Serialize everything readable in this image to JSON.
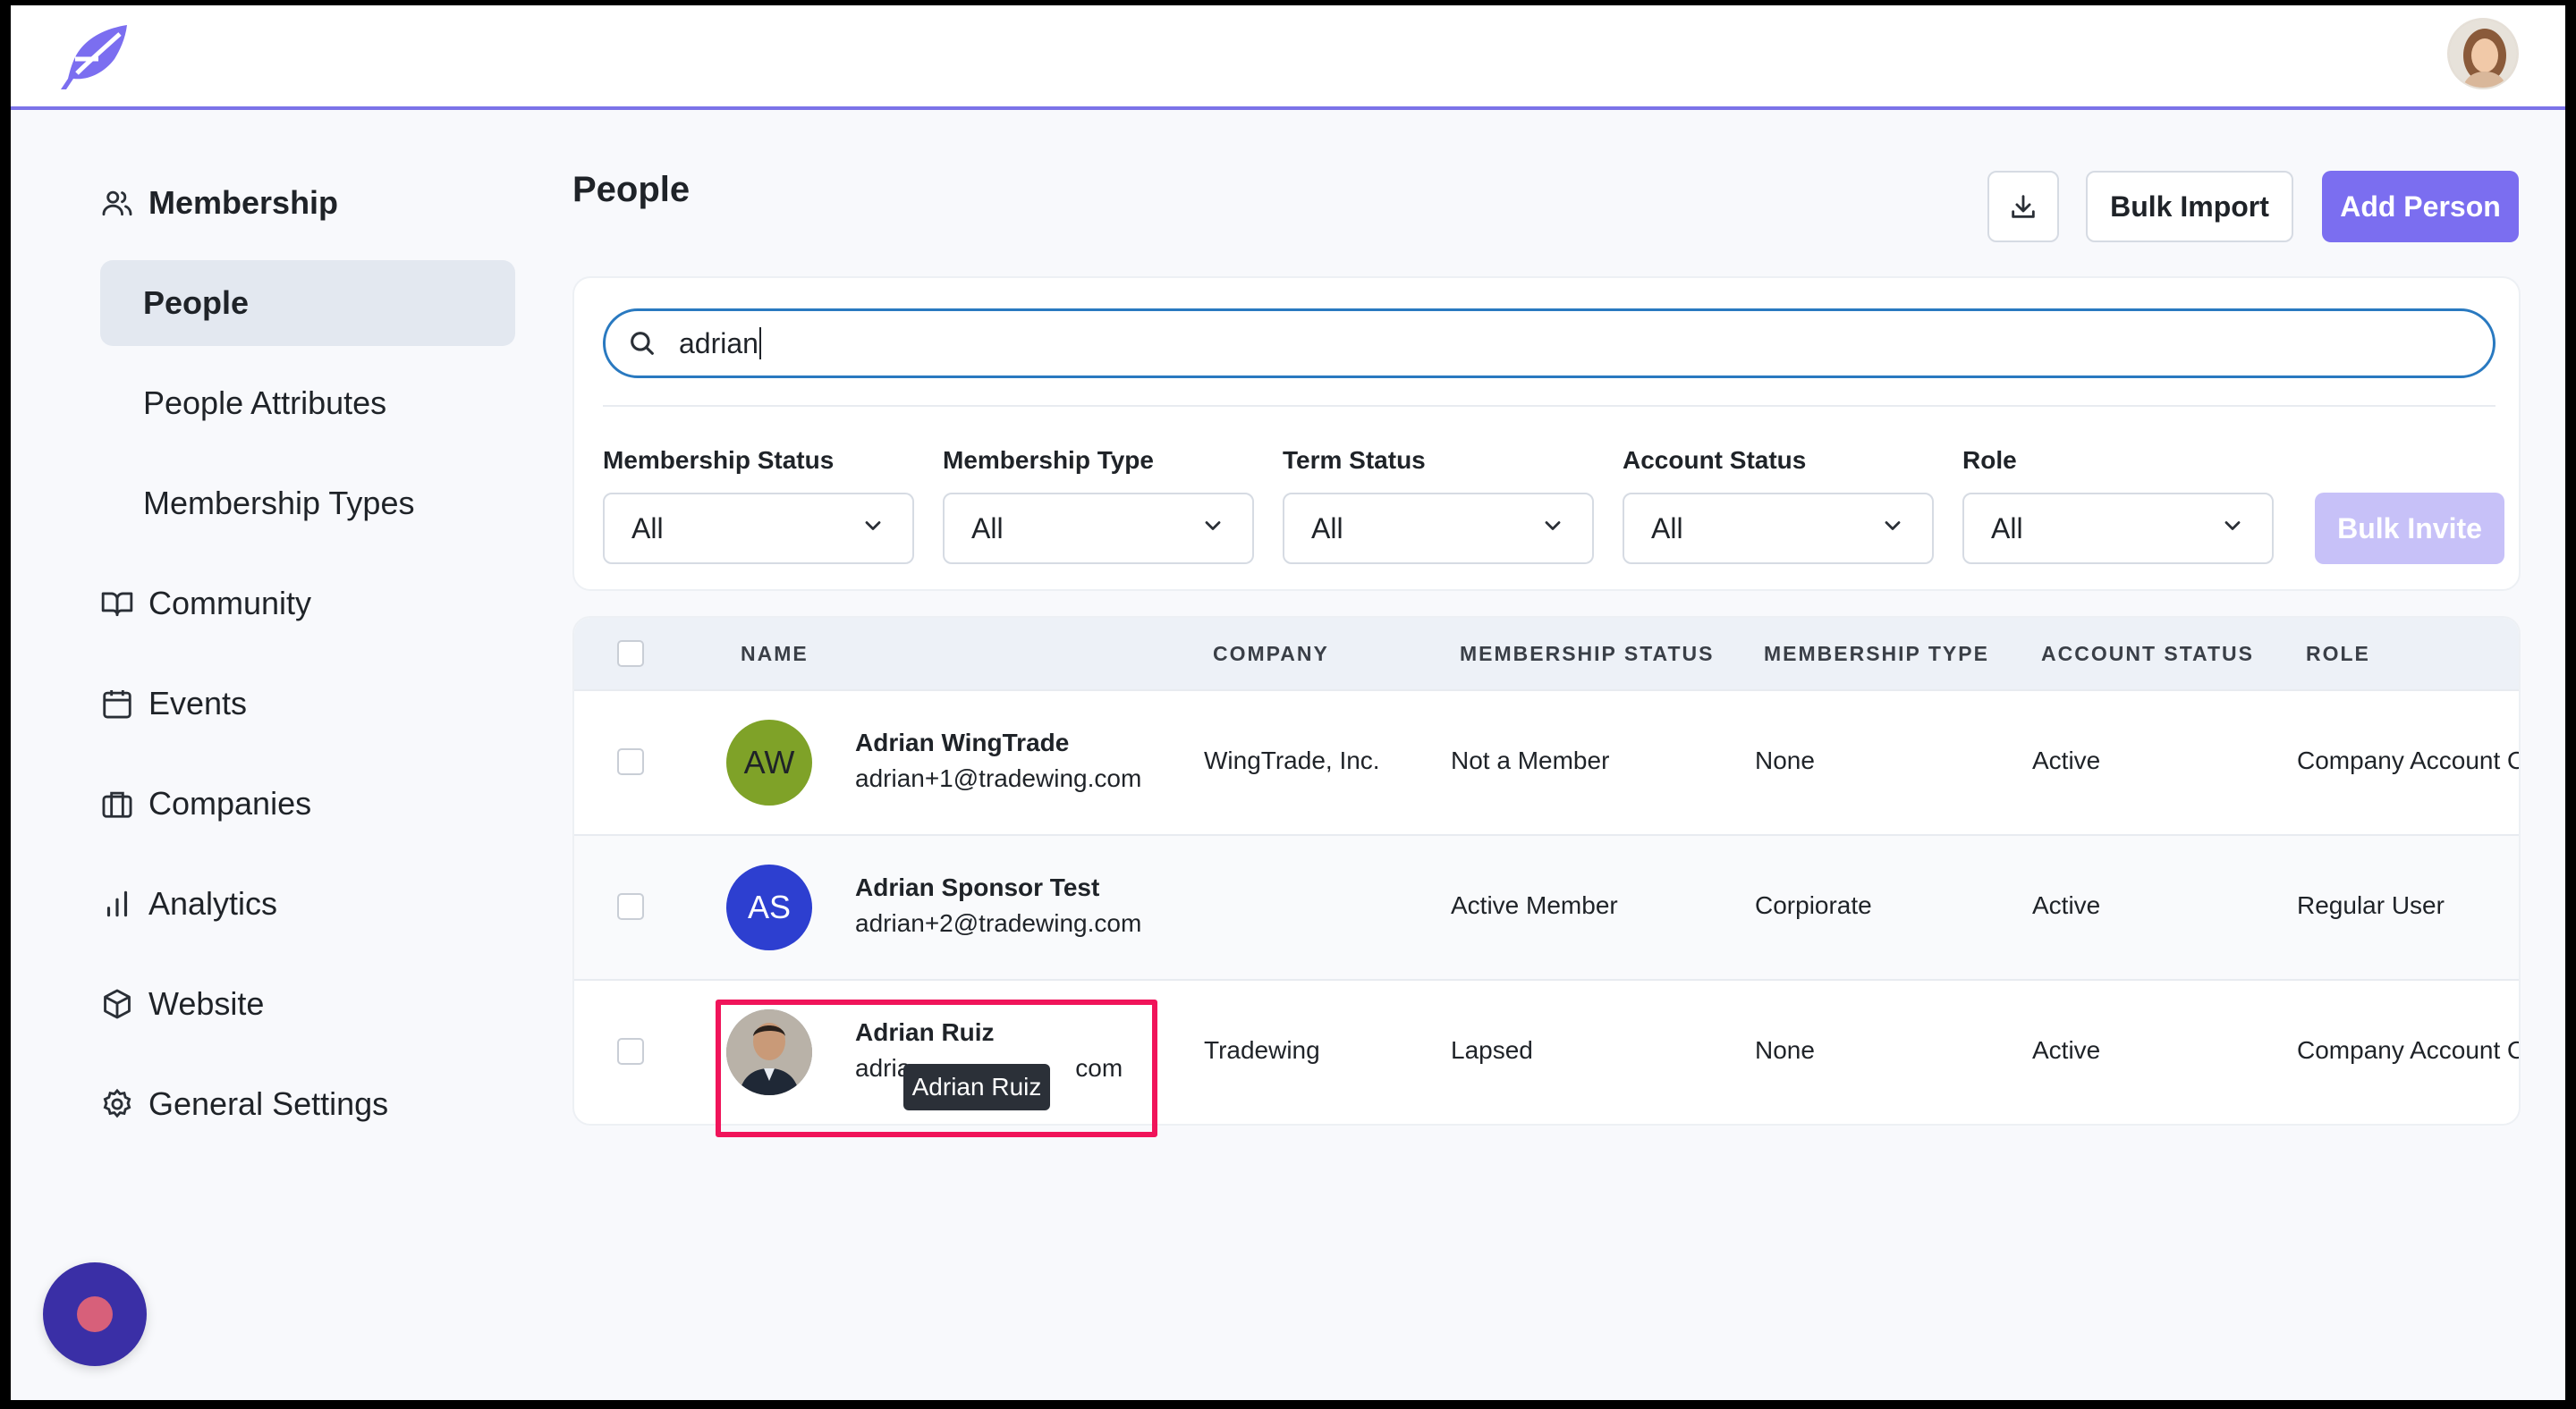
{
  "brand": {
    "accent": "#7b6ef0",
    "focus": "#2979c0",
    "highlight": "#f0145a"
  },
  "header": {
    "logo_icon": "feather-logo-icon",
    "user_avatar": "user-avatar-photo"
  },
  "sidebar": {
    "sections": [
      {
        "label": "Membership",
        "icon": "users-icon"
      },
      {
        "label": "Community",
        "icon": "book-open-icon"
      },
      {
        "label": "Events",
        "icon": "calendar-icon"
      },
      {
        "label": "Companies",
        "icon": "briefcase-icon"
      },
      {
        "label": "Analytics",
        "icon": "bar-chart-icon"
      },
      {
        "label": "Website",
        "icon": "cube-icon"
      },
      {
        "label": "General Settings",
        "icon": "gear-icon"
      }
    ],
    "membership_items": [
      {
        "label": "People",
        "active": true
      },
      {
        "label": "People Attributes",
        "active": false
      },
      {
        "label": "Membership Types",
        "active": false
      }
    ]
  },
  "main": {
    "title": "People",
    "bulk_import_label": "Bulk Import",
    "add_person_label": "Add Person",
    "download_icon": "download-icon",
    "search": {
      "value": "adrian",
      "icon": "search-icon"
    },
    "filters": [
      {
        "label": "Membership Status",
        "value": "All"
      },
      {
        "label": "Membership Type",
        "value": "All"
      },
      {
        "label": "Term Status",
        "value": "All"
      },
      {
        "label": "Account Status",
        "value": "All"
      },
      {
        "label": "Role",
        "value": "All"
      }
    ],
    "bulk_invite_label": "Bulk Invite"
  },
  "table": {
    "columns": [
      "NAME",
      "COMPANY",
      "MEMBERSHIP STATUS",
      "MEMBERSHIP TYPE",
      "ACCOUNT STATUS",
      "ROLE"
    ],
    "rows": [
      {
        "initials": "AW",
        "avatar_color": "#7fa228",
        "name": "Adrian WingTrade",
        "email": "adrian+1@tradewing.com",
        "company": "WingTrade, Inc.",
        "membership_status": "Not a Member",
        "membership_type": "None",
        "account_status": "Active",
        "role": "Company Account Ow"
      },
      {
        "initials": "AS",
        "avatar_color": "#2d3fd0",
        "name": "Adrian Sponsor Test",
        "email": "adrian+2@tradewing.com",
        "company": "",
        "membership_status": "Active Member",
        "membership_type": "Corpiorate",
        "account_status": "Active",
        "role": "Regular User"
      },
      {
        "initials": "",
        "avatar_color": "#8a8f96",
        "name": "Adrian Ruiz",
        "email": "adria",
        "email_end": "com",
        "company": "Tradewing",
        "membership_status": "Lapsed",
        "membership_type": "None",
        "account_status": "Active",
        "role": "Company Account Ow"
      }
    ]
  },
  "tooltip": {
    "text": "Adrian Ruiz"
  },
  "launcher": {
    "icon": "chat-launcher-icon"
  }
}
